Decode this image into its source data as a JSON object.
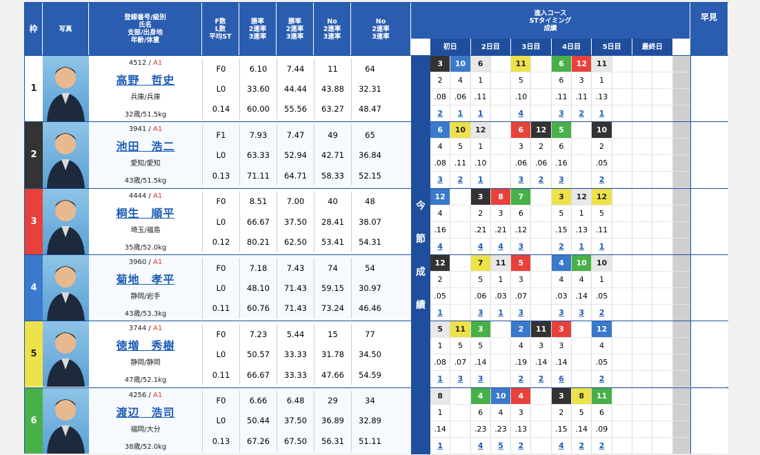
{
  "headers": {
    "waku": "枠",
    "photo": "写真",
    "reg": "登録番号/級別",
    "name": "氏名",
    "branch": "支部/出身地",
    "age": "年齢/体重",
    "f": "F数",
    "l": "L数",
    "st": "平均ST",
    "rate1": "勝率",
    "rate1b": "2連率",
    "rate1c": "3連率",
    "rate2": "勝率",
    "rate2b": "2連率",
    "rate2c": "3連率",
    "no1": "No",
    "no1b": "2連率",
    "no1c": "3連率",
    "no2": "No",
    "no2b": "2連率",
    "no2c": "3連率",
    "course": "進入コース",
    "timing": "STタイミング",
    "result": "成績",
    "hayami": "早見",
    "days": [
      "初日",
      "2日目",
      "3日目",
      "4日目",
      "5日目",
      "最終日"
    ],
    "today": [
      "今",
      "節",
      "成",
      "績"
    ]
  },
  "colors": {
    "frame1": "#ffffff",
    "frame2": "#333333",
    "frame3": "#e8413c",
    "frame4": "#3a79cc",
    "frame5": "#eee24a",
    "frame6": "#47b048"
  },
  "racers": [
    {
      "waku": "1",
      "reg": "4512",
      "cls": "A1",
      "name": "高野　哲史",
      "branch": "兵庫/兵庫",
      "age": "32歳/51.5kg",
      "f": "F0",
      "l": "L0",
      "st": "0.14",
      "r1": [
        "6.10",
        "33.60",
        "60.00"
      ],
      "r2": [
        "7.44",
        "44.44",
        "55.56"
      ],
      "n1": [
        "11",
        "43.88",
        "63.27"
      ],
      "n2": [
        "64",
        "32.31",
        "48.47"
      ],
      "course": [
        {
          "v": "3",
          "c": "b2"
        },
        {
          "v": "10",
          "c": "b4"
        },
        {
          "v": "6",
          "c": "bx"
        },
        {
          "v": "",
          "c": "b1"
        },
        {
          "v": "11",
          "c": "b5"
        },
        {
          "v": "",
          "c": "b1"
        },
        {
          "v": "6",
          "c": "b6"
        },
        {
          "v": "12",
          "c": "b3"
        },
        {
          "v": "11",
          "c": "bx"
        },
        {
          "v": "",
          "c": "b1"
        },
        {
          "v": "",
          "c": "b1"
        },
        {
          "v": "",
          "c": "b1"
        }
      ],
      "cnum": [
        "2",
        "4",
        "1",
        "",
        "5",
        "",
        "6",
        "3",
        "1",
        "",
        "",
        ""
      ],
      "st_t": [
        ".08",
        ".06",
        ".11",
        "",
        ".10",
        "",
        ".11",
        ".11",
        ".13",
        "",
        "",
        ""
      ],
      "res": [
        "2",
        "1",
        "1",
        "",
        "4",
        "",
        "3",
        "2",
        "1",
        "",
        "",
        ""
      ]
    },
    {
      "waku": "2",
      "reg": "3941",
      "cls": "A1",
      "name": "池田　浩二",
      "branch": "愛知/愛知",
      "age": "43歳/51.5kg",
      "f": "F1",
      "l": "L0",
      "st": "0.13",
      "r1": [
        "7.93",
        "63.33",
        "71.11"
      ],
      "r2": [
        "7.47",
        "52.94",
        "64.71"
      ],
      "n1": [
        "49",
        "42.71",
        "58.33"
      ],
      "n2": [
        "65",
        "36.84",
        "52.15"
      ],
      "course": [
        {
          "v": "6",
          "c": "b4"
        },
        {
          "v": "10",
          "c": "b5"
        },
        {
          "v": "12",
          "c": "bx"
        },
        {
          "v": "",
          "c": "b1"
        },
        {
          "v": "6",
          "c": "b3"
        },
        {
          "v": "12",
          "c": "b2"
        },
        {
          "v": "5",
          "c": "b6"
        },
        {
          "v": "",
          "c": "b1"
        },
        {
          "v": "10",
          "c": "b2"
        },
        {
          "v": "",
          "c": "b1"
        },
        {
          "v": "",
          "c": "b1"
        },
        {
          "v": "",
          "c": "b1"
        }
      ],
      "cnum": [
        "4",
        "5",
        "1",
        "",
        "3",
        "2",
        "6",
        "",
        "2",
        "",
        "",
        ""
      ],
      "st_t": [
        ".08",
        ".11",
        ".10",
        "",
        ".06",
        ".06",
        ".16",
        "",
        ".05",
        "",
        "",
        ""
      ],
      "res": [
        "3",
        "2",
        "1",
        "",
        "3",
        "2",
        "3",
        "",
        "2",
        "",
        "",
        ""
      ]
    },
    {
      "waku": "3",
      "reg": "4444",
      "cls": "A1",
      "name": "桐生　順平",
      "branch": "埼玉/福島",
      "age": "35歳/52.0kg",
      "f": "F0",
      "l": "L0",
      "st": "0.12",
      "r1": [
        "8.51",
        "66.67",
        "80.21"
      ],
      "r2": [
        "7.00",
        "37.50",
        "62.50"
      ],
      "n1": [
        "40",
        "28.41",
        "53.41"
      ],
      "n2": [
        "48",
        "38.07",
        "54.31"
      ],
      "course": [
        {
          "v": "12",
          "c": "b4"
        },
        {
          "v": "",
          "c": "b1"
        },
        {
          "v": "3",
          "c": "b2"
        },
        {
          "v": "8",
          "c": "b3"
        },
        {
          "v": "7",
          "c": "b6"
        },
        {
          "v": "",
          "c": "b1"
        },
        {
          "v": "3",
          "c": "b5"
        },
        {
          "v": "12",
          "c": "bx"
        },
        {
          "v": "12",
          "c": "b5"
        },
        {
          "v": "",
          "c": "b1"
        },
        {
          "v": "",
          "c": "b1"
        },
        {
          "v": "",
          "c": "b1"
        }
      ],
      "cnum": [
        "4",
        "",
        "2",
        "3",
        "6",
        "",
        "5",
        "1",
        "5",
        "",
        "",
        ""
      ],
      "st_t": [
        ".16",
        "",
        ".21",
        ".21",
        ".12",
        "",
        ".15",
        ".13",
        ".11",
        "",
        "",
        ""
      ],
      "res": [
        "4",
        "",
        "4",
        "4",
        "3",
        "",
        "2",
        "1",
        "1",
        "",
        "",
        ""
      ]
    },
    {
      "waku": "4",
      "reg": "3960",
      "cls": "A1",
      "name": "菊地　孝平",
      "branch": "静岡/岩手",
      "age": "43歳/53.3kg",
      "f": "F0",
      "l": "L0",
      "st": "0.11",
      "r1": [
        "7.18",
        "48.10",
        "60.76"
      ],
      "r2": [
        "7.43",
        "71.43",
        "71.43"
      ],
      "n1": [
        "74",
        "59.15",
        "73.24"
      ],
      "n2": [
        "54",
        "30.97",
        "46.46"
      ],
      "course": [
        {
          "v": "12",
          "c": "b2"
        },
        {
          "v": "",
          "c": "b1"
        },
        {
          "v": "7",
          "c": "b5"
        },
        {
          "v": "11",
          "c": "bx"
        },
        {
          "v": "5",
          "c": "b3"
        },
        {
          "v": "",
          "c": "b1"
        },
        {
          "v": "4",
          "c": "b4"
        },
        {
          "v": "10",
          "c": "b6"
        },
        {
          "v": "10",
          "c": "bx"
        },
        {
          "v": "",
          "c": "b1"
        },
        {
          "v": "",
          "c": "b1"
        },
        {
          "v": "",
          "c": "b1"
        }
      ],
      "cnum": [
        "2",
        "",
        "5",
        "1",
        "3",
        "",
        "4",
        "4",
        "1",
        "",
        "",
        ""
      ],
      "st_t": [
        ".05",
        "",
        ".06",
        ".03",
        ".07",
        "",
        ".03",
        ".14",
        ".05",
        "",
        "",
        ""
      ],
      "res": [
        "1",
        "",
        "3",
        "1",
        "3",
        "",
        "3",
        "3",
        "2",
        "",
        "",
        ""
      ]
    },
    {
      "waku": "5",
      "reg": "3744",
      "cls": "A1",
      "name": "徳増　秀樹",
      "branch": "静岡/静岡",
      "age": "47歳/52.1kg",
      "f": "F0",
      "l": "L0",
      "st": "0.11",
      "r1": [
        "7.23",
        "50.57",
        "66.67"
      ],
      "r2": [
        "5.44",
        "33.33",
        "33.33"
      ],
      "n1": [
        "15",
        "31.78",
        "47.66"
      ],
      "n2": [
        "77",
        "34.50",
        "54.59"
      ],
      "course": [
        {
          "v": "5",
          "c": "bx"
        },
        {
          "v": "11",
          "c": "b5"
        },
        {
          "v": "3",
          "c": "b6"
        },
        {
          "v": "",
          "c": "b1"
        },
        {
          "v": "2",
          "c": "b4"
        },
        {
          "v": "11",
          "c": "b2"
        },
        {
          "v": "3",
          "c": "b3"
        },
        {
          "v": "",
          "c": "b1"
        },
        {
          "v": "12",
          "c": "b4"
        },
        {
          "v": "",
          "c": "b1"
        },
        {
          "v": "",
          "c": "b1"
        },
        {
          "v": "",
          "c": "b1"
        }
      ],
      "cnum": [
        "1",
        "5",
        "5",
        "",
        "4",
        "3",
        "3",
        "",
        "4",
        "",
        "",
        ""
      ],
      "st_t": [
        ".08",
        ".07",
        ".14",
        "",
        ".19",
        ".14",
        ".14",
        "",
        ".05",
        "",
        "",
        ""
      ],
      "res": [
        "1",
        "3",
        "3",
        "",
        "2",
        "2",
        "6",
        "",
        "2",
        "",
        "",
        ""
      ]
    },
    {
      "waku": "6",
      "reg": "4256",
      "cls": "A1",
      "name": "渡辺　浩司",
      "branch": "福岡/大分",
      "age": "38歳/52.0kg",
      "f": "F0",
      "l": "L0",
      "st": "0.13",
      "r1": [
        "6.66",
        "50.44",
        "67.26"
      ],
      "r2": [
        "6.48",
        "37.50",
        "67.50"
      ],
      "n1": [
        "29",
        "36.89",
        "56.31"
      ],
      "n2": [
        "34",
        "32.89",
        "51.11"
      ],
      "course": [
        {
          "v": "8",
          "c": "bx"
        },
        {
          "v": "",
          "c": "b1"
        },
        {
          "v": "4",
          "c": "b6"
        },
        {
          "v": "10",
          "c": "b4"
        },
        {
          "v": "4",
          "c": "b3"
        },
        {
          "v": "",
          "c": "b1"
        },
        {
          "v": "3",
          "c": "b2"
        },
        {
          "v": "8",
          "c": "b5"
        },
        {
          "v": "11",
          "c": "b6"
        },
        {
          "v": "",
          "c": "b1"
        },
        {
          "v": "",
          "c": "b1"
        },
        {
          "v": "",
          "c": "b1"
        }
      ],
      "cnum": [
        "1",
        "",
        "6",
        "4",
        "3",
        "",
        "2",
        "5",
        "6",
        "",
        "",
        ""
      ],
      "st_t": [
        ".14",
        "",
        ".23",
        ".23",
        ".13",
        "",
        ".15",
        ".14",
        ".09",
        "",
        "",
        ""
      ],
      "res": [
        "1",
        "",
        "4",
        "5",
        "2",
        "",
        "4",
        "2",
        "2",
        "",
        "",
        ""
      ]
    }
  ]
}
